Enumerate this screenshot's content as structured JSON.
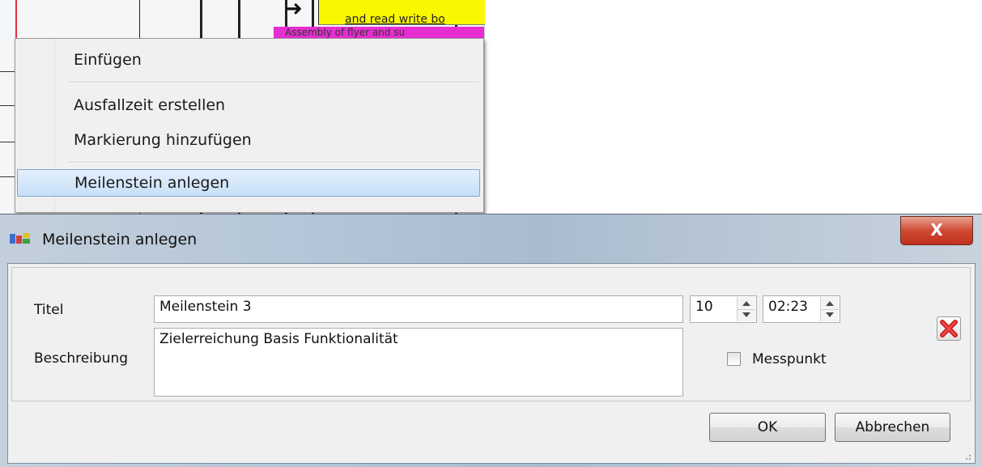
{
  "gantt": {
    "task_text_1": "and read write bo",
    "task_text_2": "Assembly of flyer and su"
  },
  "context_menu": {
    "items": [
      {
        "label": "Einfügen"
      },
      {
        "label": "Ausfallzeit erstellen"
      },
      {
        "label": "Markierung hinzufügen"
      },
      {
        "label": "Meilenstein anlegen",
        "selected": true
      }
    ]
  },
  "dialog": {
    "title": "Meilenstein anlegen",
    "close_label": "X",
    "titel_label": "Titel",
    "titel_value": "Meilenstein 3",
    "beschreibung_label": "Beschreibung",
    "beschreibung_value": "Zielerreichung Basis Funktionalität",
    "day_value": "10",
    "time_value": "02:23",
    "messpunkt_label": "Messpunkt",
    "messpunkt_checked": false,
    "ok_label": "OK",
    "cancel_label": "Abbrechen",
    "colors": {
      "delete_icon": "#d02020",
      "selection": "#c7e0f8"
    }
  }
}
